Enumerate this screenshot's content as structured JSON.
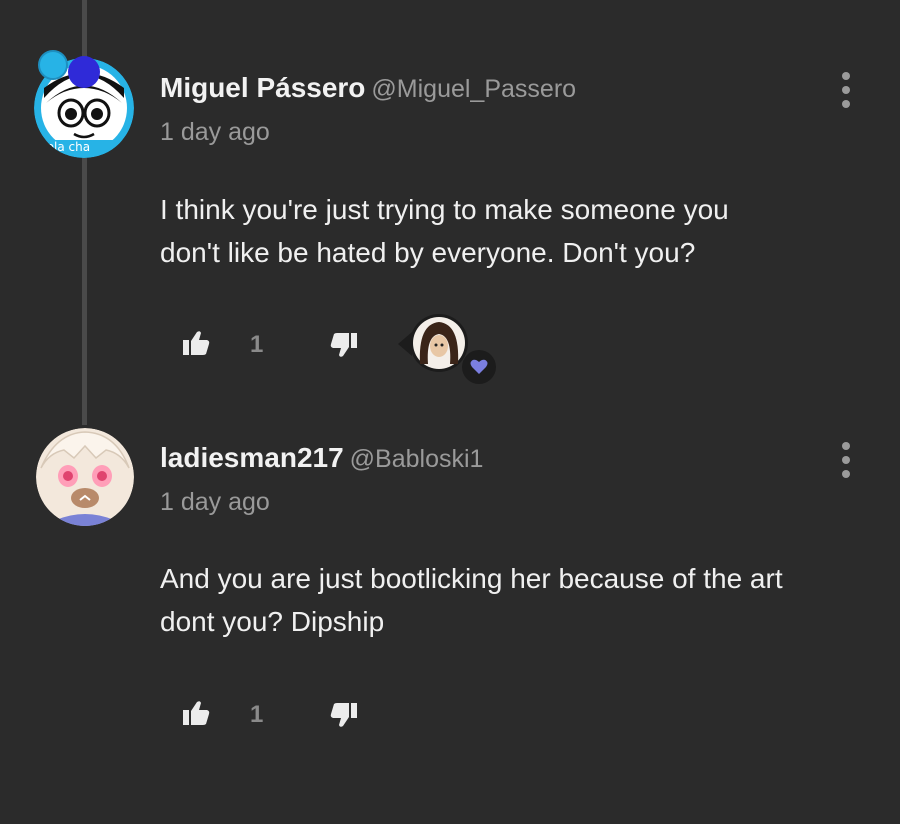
{
  "comments": [
    {
      "author_name": "Miguel Pássero",
      "author_handle": "@Miguel_Passero",
      "time": "1 day ago",
      "text_line1": "I think you're just trying to make someone you",
      "text_line2": "don't like be hated by everyone. Don't you?",
      "like_count": "1",
      "avatar_badge_text": "tola cha",
      "creator_heart": true
    },
    {
      "author_name": "ladiesman217",
      "author_handle": "@Babloski1",
      "time": "1 day ago",
      "text_line1": "And you are just bootlicking her because of the art",
      "text_line2": "dont you? Dipship",
      "like_count": "1",
      "creator_heart": false
    }
  ],
  "colors": {
    "background": "#2b2b2b",
    "thread_line": "#4a4a4a",
    "muted_text": "#9a9a9a",
    "heart": "#7b7fe0",
    "avatar1_ring": "#27b3e6"
  }
}
